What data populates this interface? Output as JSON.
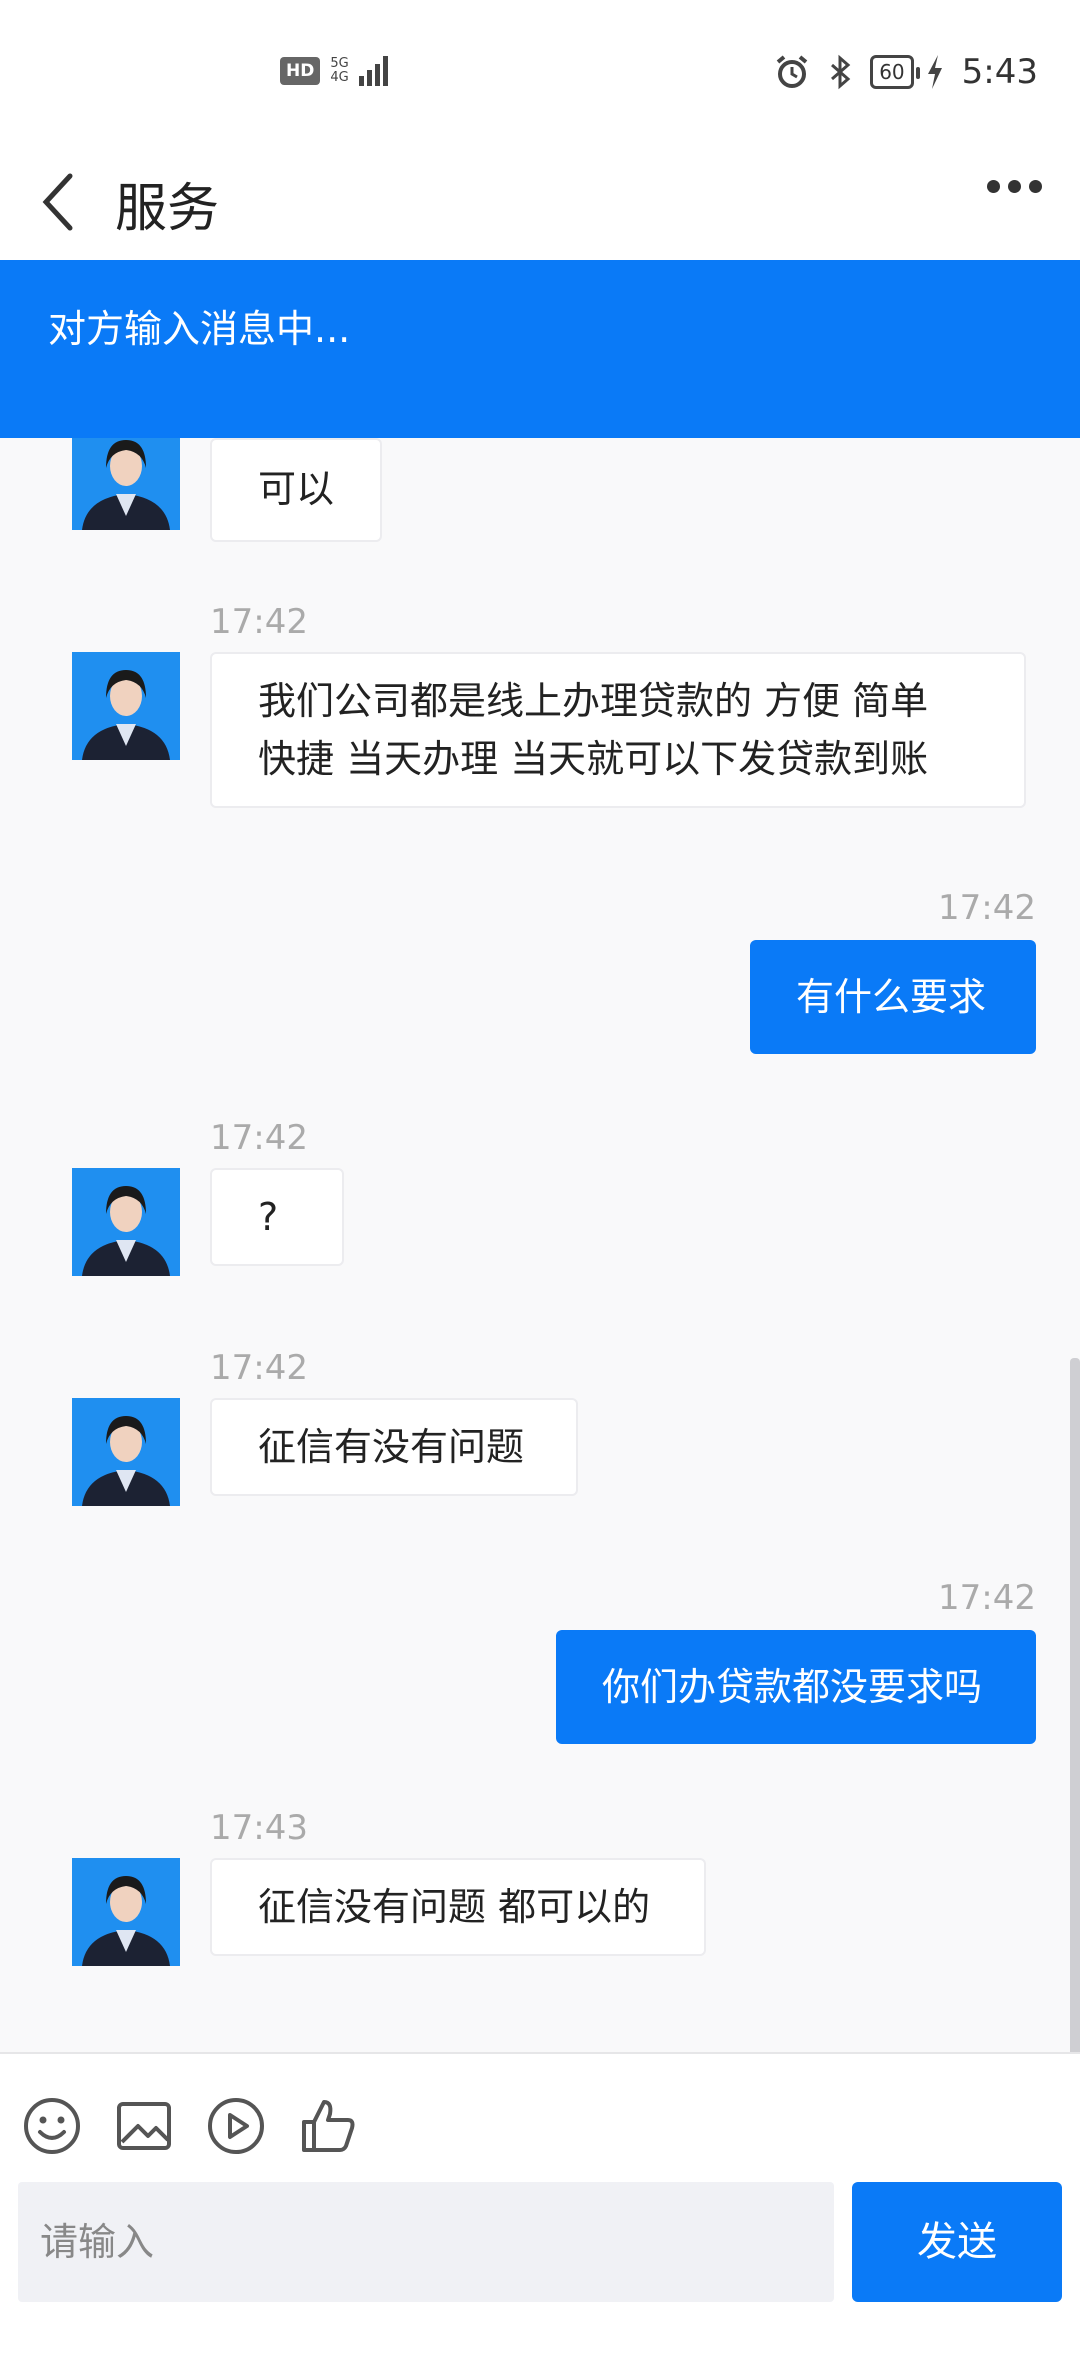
{
  "status_bar": {
    "hd_label": "HD",
    "network_label": "5G",
    "network_sub": "4G",
    "battery_level": "60",
    "time": "5:43"
  },
  "header": {
    "title": "服务"
  },
  "typing_banner": "对方输入消息中...",
  "messages": [
    {
      "side": "in",
      "time": "",
      "text": "可以"
    },
    {
      "side": "in",
      "time": "17:42",
      "text": "我们公司都是线上办理贷款的 方便 简单 快捷 当天办理 当天就可以下发贷款到账"
    },
    {
      "side": "out",
      "time": "17:42",
      "text": "有什么要求"
    },
    {
      "side": "in",
      "time": "17:42",
      "text": "?"
    },
    {
      "side": "in",
      "time": "17:42",
      "text": "征信有没有问题"
    },
    {
      "side": "out",
      "time": "17:42",
      "text": "你们办贷款都没要求吗"
    },
    {
      "side": "in",
      "time": "17:43",
      "text": "征信没有问题 都可以的"
    }
  ],
  "composer": {
    "placeholder": "请输入",
    "send_label": "发送"
  },
  "colors": {
    "accent": "#0a7af7",
    "background": "#f9f9fa"
  }
}
